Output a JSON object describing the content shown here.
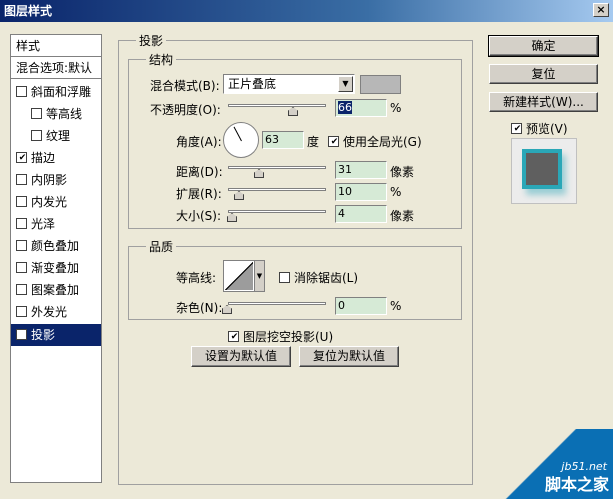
{
  "window": {
    "title": "图层样式",
    "close_label": "×"
  },
  "left_panel": {
    "header": "样式",
    "blend_options": "混合选项:默认",
    "items": [
      {
        "label": "斜面和浮雕",
        "checked": false
      },
      {
        "label": "等高线",
        "checked": false
      },
      {
        "label": "纹理",
        "checked": false
      },
      {
        "label": "描边",
        "checked": true
      },
      {
        "label": "内阴影",
        "checked": false
      },
      {
        "label": "内发光",
        "checked": false
      },
      {
        "label": "光泽",
        "checked": false
      },
      {
        "label": "颜色叠加",
        "checked": false
      },
      {
        "label": "渐变叠加",
        "checked": false
      },
      {
        "label": "图案叠加",
        "checked": false
      },
      {
        "label": "外发光",
        "checked": false
      },
      {
        "label": "投影",
        "checked": true
      }
    ]
  },
  "main": {
    "section_title": "投影",
    "structure": {
      "title": "结构",
      "blend_mode_label": "混合模式(B):",
      "blend_mode_value": "正片叠底",
      "opacity_label": "不透明度(O):",
      "opacity_value": "66",
      "opacity_unit": "%",
      "opacity_fraction": 0.66,
      "angle_label": "角度(A):",
      "angle_value": "63",
      "angle_unit": "度",
      "global_light_label": "使用全局光(G)",
      "global_light_checked": true,
      "distance_label": "距离(D):",
      "distance_value": "31",
      "distance_unit": "像素",
      "spread_label": "扩展(R):",
      "spread_value": "10",
      "spread_unit": "%",
      "size_label": "大小(S):",
      "size_value": "4",
      "size_unit": "像素"
    },
    "quality": {
      "title": "品质",
      "contour_label": "等高线:",
      "antialias_label": "消除锯齿(L)",
      "antialias_checked": false,
      "noise_label": "杂色(N):",
      "noise_value": "0",
      "noise_unit": "%"
    },
    "knockout_label": "图层挖空投影(U)",
    "knockout_checked": true,
    "set_default_label": "设置为默认值",
    "reset_default_label": "复位为默认值"
  },
  "right": {
    "ok_label": "确定",
    "reset_label": "复位",
    "new_style_label": "新建样式(W)...",
    "preview_label": "预览(V)",
    "preview_checked": true
  },
  "watermark": {
    "line1": "jb51.net",
    "line2": "脚本之家"
  }
}
